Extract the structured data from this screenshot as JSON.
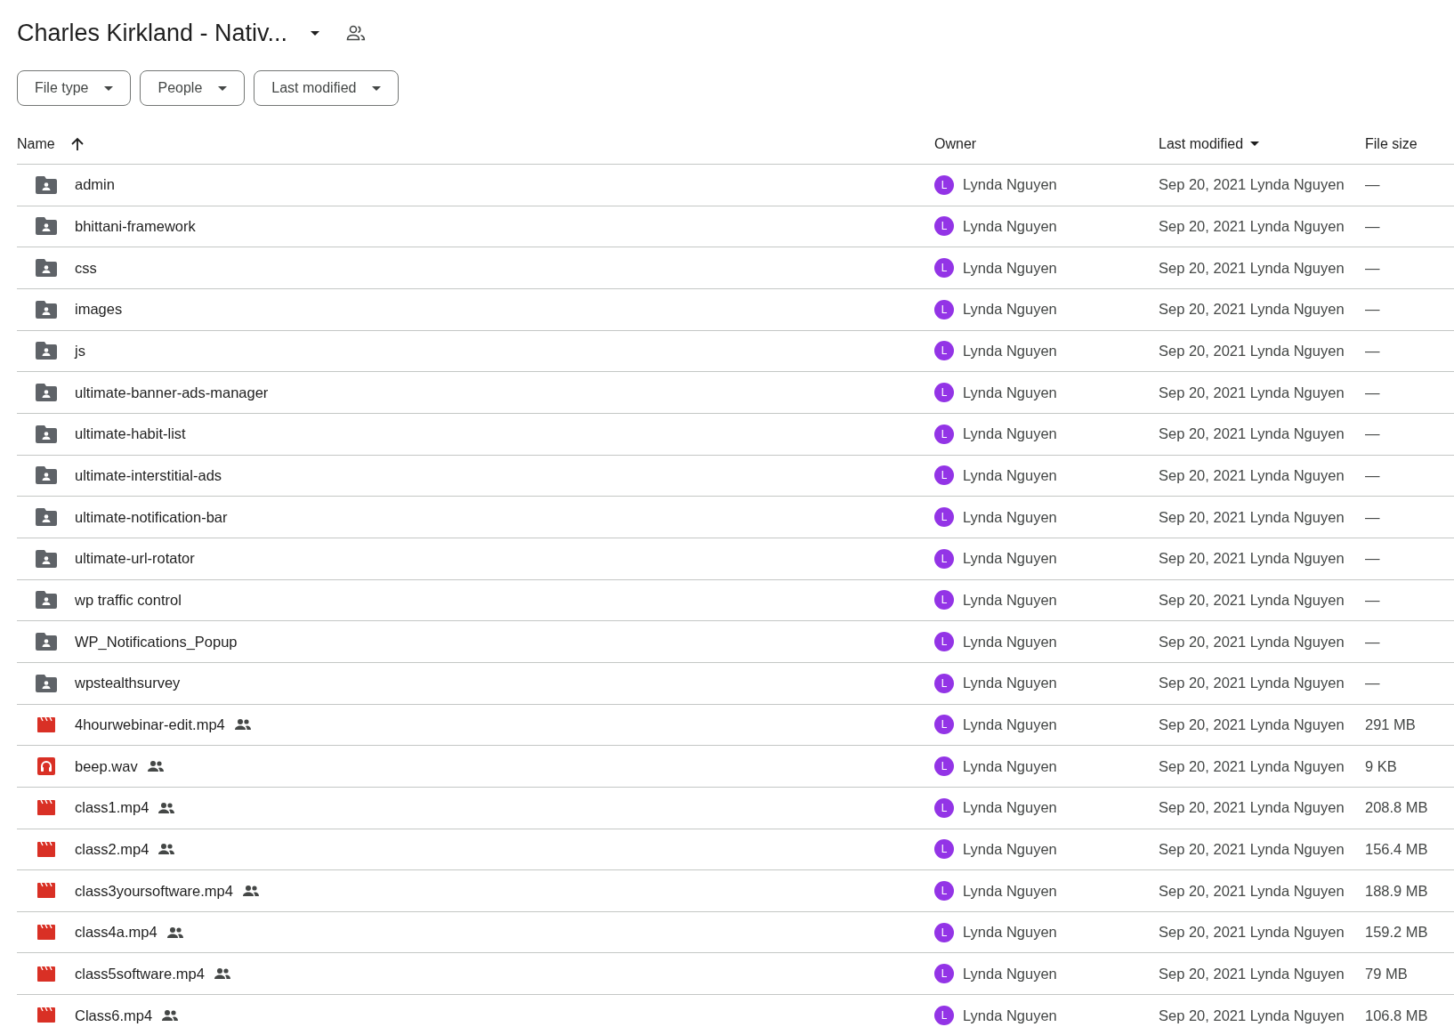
{
  "title": "Charles Kirkland - Nativ...",
  "filters": [
    {
      "label": "File type"
    },
    {
      "label": "People"
    },
    {
      "label": "Last modified"
    }
  ],
  "columns": [
    {
      "label": "Name",
      "sorted": true,
      "descending": false
    },
    {
      "label": "Owner",
      "sorted": false
    },
    {
      "label": "Last modified",
      "sorted": true,
      "descending": true
    },
    {
      "label": "File size",
      "sorted": false
    }
  ],
  "rows": [
    {
      "kind": "folder",
      "name": "admin",
      "shared": false,
      "owner_initial": "L",
      "owner": "Lynda Nguyen",
      "modified": "Sep 20, 2021 Lynda Nguyen",
      "size": "—"
    },
    {
      "kind": "folder",
      "name": "bhittani-framework",
      "shared": false,
      "owner_initial": "L",
      "owner": "Lynda Nguyen",
      "modified": "Sep 20, 2021 Lynda Nguyen",
      "size": "—"
    },
    {
      "kind": "folder",
      "name": "css",
      "shared": false,
      "owner_initial": "L",
      "owner": "Lynda Nguyen",
      "modified": "Sep 20, 2021 Lynda Nguyen",
      "size": "—"
    },
    {
      "kind": "folder",
      "name": "images",
      "shared": false,
      "owner_initial": "L",
      "owner": "Lynda Nguyen",
      "modified": "Sep 20, 2021 Lynda Nguyen",
      "size": "—"
    },
    {
      "kind": "folder",
      "name": "js",
      "shared": false,
      "owner_initial": "L",
      "owner": "Lynda Nguyen",
      "modified": "Sep 20, 2021 Lynda Nguyen",
      "size": "—"
    },
    {
      "kind": "folder",
      "name": "ultimate-banner-ads-manager",
      "shared": false,
      "owner_initial": "L",
      "owner": "Lynda Nguyen",
      "modified": "Sep 20, 2021 Lynda Nguyen",
      "size": "—"
    },
    {
      "kind": "folder",
      "name": "ultimate-habit-list",
      "shared": false,
      "owner_initial": "L",
      "owner": "Lynda Nguyen",
      "modified": "Sep 20, 2021 Lynda Nguyen",
      "size": "—"
    },
    {
      "kind": "folder",
      "name": "ultimate-interstitial-ads",
      "shared": false,
      "owner_initial": "L",
      "owner": "Lynda Nguyen",
      "modified": "Sep 20, 2021 Lynda Nguyen",
      "size": "—"
    },
    {
      "kind": "folder",
      "name": "ultimate-notification-bar",
      "shared": false,
      "owner_initial": "L",
      "owner": "Lynda Nguyen",
      "modified": "Sep 20, 2021 Lynda Nguyen",
      "size": "—"
    },
    {
      "kind": "folder",
      "name": "ultimate-url-rotator",
      "shared": false,
      "owner_initial": "L",
      "owner": "Lynda Nguyen",
      "modified": "Sep 20, 2021 Lynda Nguyen",
      "size": "—"
    },
    {
      "kind": "folder",
      "name": "wp traffic control",
      "shared": false,
      "owner_initial": "L",
      "owner": "Lynda Nguyen",
      "modified": "Sep 20, 2021 Lynda Nguyen",
      "size": "—"
    },
    {
      "kind": "folder",
      "name": "WP_Notifications_Popup",
      "shared": false,
      "owner_initial": "L",
      "owner": "Lynda Nguyen",
      "modified": "Sep 20, 2021 Lynda Nguyen",
      "size": "—"
    },
    {
      "kind": "folder",
      "name": "wpstealthsurvey",
      "shared": false,
      "owner_initial": "L",
      "owner": "Lynda Nguyen",
      "modified": "Sep 20, 2021 Lynda Nguyen",
      "size": "—"
    },
    {
      "kind": "video",
      "name": "4hourwebinar-edit.mp4",
      "shared": true,
      "owner_initial": "L",
      "owner": "Lynda Nguyen",
      "modified": "Sep 20, 2021 Lynda Nguyen",
      "size": "291 MB"
    },
    {
      "kind": "audio",
      "name": "beep.wav",
      "shared": true,
      "owner_initial": "L",
      "owner": "Lynda Nguyen",
      "modified": "Sep 20, 2021 Lynda Nguyen",
      "size": "9 KB"
    },
    {
      "kind": "video",
      "name": "class1.mp4",
      "shared": true,
      "owner_initial": "L",
      "owner": "Lynda Nguyen",
      "modified": "Sep 20, 2021 Lynda Nguyen",
      "size": "208.8 MB"
    },
    {
      "kind": "video",
      "name": "class2.mp4",
      "shared": true,
      "owner_initial": "L",
      "owner": "Lynda Nguyen",
      "modified": "Sep 20, 2021 Lynda Nguyen",
      "size": "156.4 MB"
    },
    {
      "kind": "video",
      "name": "class3yoursoftware.mp4",
      "shared": true,
      "owner_initial": "L",
      "owner": "Lynda Nguyen",
      "modified": "Sep 20, 2021 Lynda Nguyen",
      "size": "188.9 MB"
    },
    {
      "kind": "video",
      "name": "class4a.mp4",
      "shared": true,
      "owner_initial": "L",
      "owner": "Lynda Nguyen",
      "modified": "Sep 20, 2021 Lynda Nguyen",
      "size": "159.2 MB"
    },
    {
      "kind": "video",
      "name": "class5software.mp4",
      "shared": true,
      "owner_initial": "L",
      "owner": "Lynda Nguyen",
      "modified": "Sep 20, 2021 Lynda Nguyen",
      "size": "79 MB"
    },
    {
      "kind": "video",
      "name": "Class6.mp4",
      "shared": true,
      "owner_initial": "L",
      "owner": "Lynda Nguyen",
      "modified": "Sep 20, 2021 Lynda Nguyen",
      "size": "106.8 MB"
    }
  ]
}
